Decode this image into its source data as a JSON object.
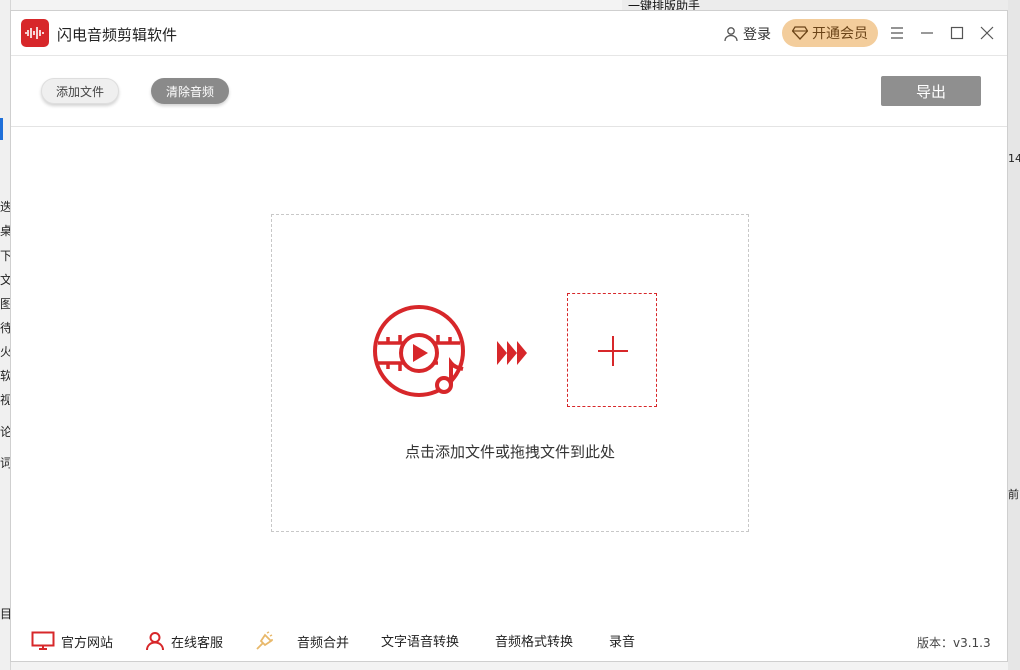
{
  "background": {
    "top_window_title": "一键排版助手",
    "left_fragments": [
      "迭",
      "桌",
      "下",
      "文",
      "图",
      "待",
      "火",
      "软",
      "视",
      "论",
      "词",
      "目"
    ],
    "right_fragments": [
      "14",
      "前"
    ]
  },
  "window": {
    "title": "闪电音频剪辑软件",
    "login_label": "登录",
    "vip_label": "开通会员"
  },
  "toolbar": {
    "add_file_label": "添加文件",
    "clear_audio_label": "清除音频",
    "export_label": "导出"
  },
  "dropzone": {
    "hint": "点击添加文件或拖拽文件到此处"
  },
  "footer": {
    "items": [
      {
        "label": "官方网站",
        "icon": "monitor-icon"
      },
      {
        "label": "在线客服",
        "icon": "user-service-icon"
      },
      {
        "label": "音频合并",
        "icon": "merge-icon"
      },
      {
        "label": "文字语音转换",
        "icon": ""
      },
      {
        "label": "音频格式转换",
        "icon": ""
      },
      {
        "label": "录音",
        "icon": ""
      }
    ],
    "version": "版本：v3.1.3"
  },
  "colors": {
    "accent": "#d7272a",
    "vip_bg": "#f3cd9c",
    "export_bg": "#8f8f8f"
  }
}
